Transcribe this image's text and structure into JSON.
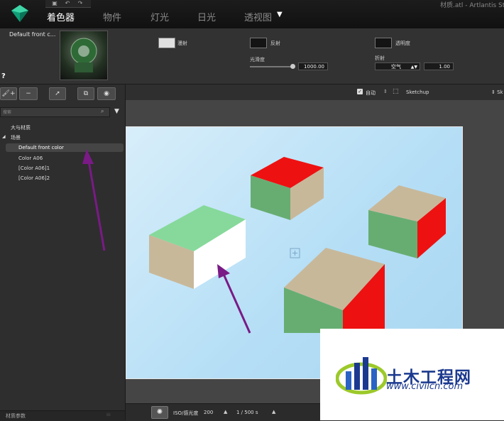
{
  "window": {
    "title": "材质.atl - Artlantis Stu"
  },
  "quick_access": {
    "icons": [
      "save-icon",
      "undo-icon",
      "redo-icon"
    ]
  },
  "tabs": [
    {
      "label": "着色器",
      "active": true
    },
    {
      "label": "物件",
      "active": false
    },
    {
      "label": "灯光",
      "active": false
    },
    {
      "label": "日光",
      "active": false
    },
    {
      "label": "透视图",
      "active": false
    }
  ],
  "material": {
    "name": "Default front c...",
    "help": "?"
  },
  "props": {
    "diffuse_label": "漫射",
    "reflect_label": "反射",
    "transparency_label": "透明度",
    "gloss_label": "光滑度",
    "gloss_value": "1000.00",
    "refraction_label": "折射",
    "refraction_select": "空气",
    "refraction_value": "1.00",
    "colors": {
      "diffuse": "#e0e0e0",
      "reflect": "#141414",
      "transparency": "#141414"
    }
  },
  "left_toolbar": {
    "add": "+",
    "remove": "−"
  },
  "search": {
    "placeholder": "搜索"
  },
  "tree": {
    "root1": "大与材质",
    "root2": "场景",
    "items": [
      "Default front color",
      "Color A06",
      "[Color A06]1",
      "[Color A06]2"
    ],
    "selected": "Default front color"
  },
  "left_footer": {
    "label": "材质参数"
  },
  "view_toolbar": {
    "auto_label": "自动",
    "sketchup_label": "Sketchup",
    "right_label": "Sk"
  },
  "bottom_bar": {
    "iso_label": "ISO/感光度",
    "iso_value": "200",
    "shutter_value": "1 / 500 s"
  },
  "watermark": {
    "text": "土木工程网",
    "url": "www.civilcn.com"
  },
  "scene_colors": {
    "sky": "#b6dff6",
    "red": "#ee1111",
    "green": "#67ad72",
    "tan": "#c8b89a",
    "light_green": "#86d99a",
    "white": "#ffffff",
    "arrow": "#7a1a86"
  }
}
